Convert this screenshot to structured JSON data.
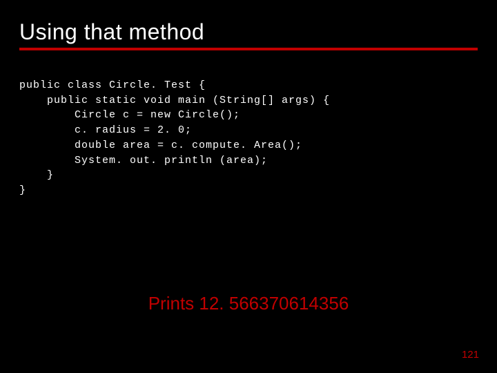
{
  "title": "Using that method",
  "code_lines": [
    "public class Circle. Test {",
    "    public static void main (String[] args) {",
    "        Circle c = new Circle();",
    "        c. radius = 2. 0;",
    "        double area = c. compute. Area();",
    "        System. out. println (area);",
    "    }",
    "}"
  ],
  "prints_text": "Prints 12. 566370614356",
  "page_number": "121",
  "colors": {
    "background": "#000000",
    "text": "#ffffff",
    "accent": "#c00000"
  }
}
